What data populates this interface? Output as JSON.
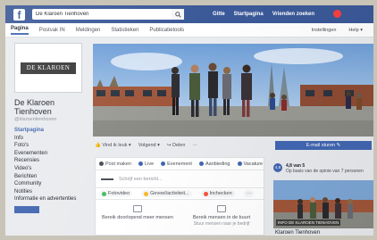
{
  "topbar": {
    "logo": "f",
    "search_value": "De Klaroen Tienhoven",
    "links": [
      "Gitte",
      "Startpagina",
      "Vrienden zoeken"
    ]
  },
  "tabs": {
    "items": [
      "Pagina",
      "Postvak IN",
      "Meldingen",
      "Statistieken",
      "Publicatietools"
    ],
    "right": [
      "Instellingen",
      "Help ▾"
    ]
  },
  "profile": {
    "logo_text": "DE KLAROEN",
    "name": "De Klaroen Tienhoven",
    "handle": "@klaroentienhoven"
  },
  "left_nav": [
    "Startpagina",
    "Info",
    "Foto's",
    "Evenementen",
    "Recensies",
    "Video's",
    "Berichten",
    "Community",
    "Notities",
    "Informatie en advertenties"
  ],
  "actions": {
    "liked": "👍 Vind ik leuk ▾",
    "following": "Volgend ▾",
    "share": "↪ Delen",
    "more": "···",
    "cta": "E-mail sturen ✎"
  },
  "composer": {
    "tabs": [
      "Post maken",
      "Live",
      "Evenement",
      "Aanbieding",
      "Vacature"
    ],
    "placeholder": "Schrijf een bericht...",
    "options": [
      "Fotovideo",
      "Gevoel/activiteit...",
      "Inchecken"
    ],
    "more": "···",
    "bottom": [
      {
        "title": "Bereik doorlopend meer mensen",
        "sub": ""
      },
      {
        "title": "Bereik mensen in de buurt",
        "sub": "Stuur mensen naar je bedrijf"
      }
    ]
  },
  "rating": {
    "badge": "4,8",
    "score": "4,8 van 5",
    "text": "Op basis van de opinie van 7 personen"
  },
  "video": {
    "label": "INFO DE KLAROEN TIENHOVEN",
    "title": "Klaroen Tienhoven"
  },
  "colors": {
    "facebook_blue": "#3b5998",
    "button_blue": "#4267b2",
    "background": "#e9ebee",
    "notification_red": "#fa3e3e"
  }
}
